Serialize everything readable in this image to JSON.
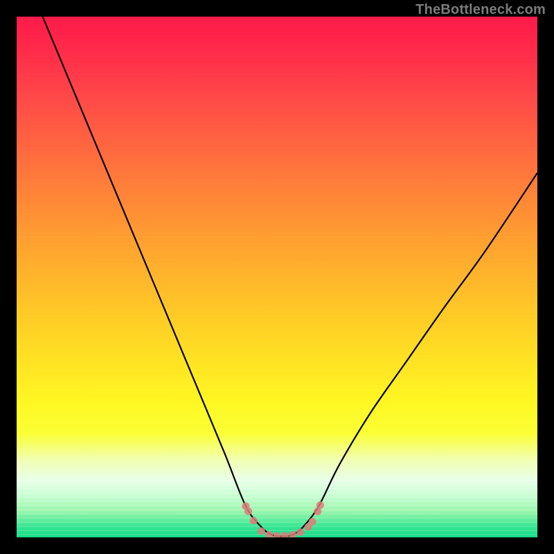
{
  "watermark": "TheBottleneck.com",
  "colors": {
    "background": "#000000",
    "gradient_top": "#ff1a4a",
    "gradient_mid": "#ffe223",
    "gradient_bottom": "#15db87",
    "curve": "#000000",
    "dot": "#e07a7a"
  },
  "chart_data": {
    "type": "line",
    "title": "",
    "xlabel": "",
    "ylabel": "",
    "xlim": [
      0,
      100
    ],
    "ylim": [
      0,
      100
    ],
    "grid": false,
    "series": [
      {
        "name": "bottleneck-curve",
        "x": [
          5,
          10,
          15,
          20,
          25,
          30,
          35,
          40,
          44,
          47,
          49,
          51,
          53,
          55,
          58,
          62,
          68,
          75,
          82,
          90,
          100
        ],
        "values": [
          100,
          88,
          76,
          64,
          52,
          40,
          28,
          16,
          6,
          2,
          0.5,
          0.2,
          0.5,
          2,
          6,
          14,
          24,
          34,
          44,
          55,
          70
        ]
      }
    ],
    "annotations": {
      "dots": [
        {
          "x": 44.0,
          "y": 6.0
        },
        {
          "x": 44.5,
          "y": 5.0
        },
        {
          "x": 45.5,
          "y": 3.2
        },
        {
          "x": 47.0,
          "y": 1.2
        },
        {
          "x": 48.5,
          "y": 0.5
        },
        {
          "x": 50.0,
          "y": 0.3
        },
        {
          "x": 51.5,
          "y": 0.3
        },
        {
          "x": 53.0,
          "y": 0.5
        },
        {
          "x": 54.5,
          "y": 1.0
        },
        {
          "x": 56.0,
          "y": 2.0
        },
        {
          "x": 56.8,
          "y": 3.0
        },
        {
          "x": 57.8,
          "y": 5.0
        },
        {
          "x": 58.3,
          "y": 6.2
        }
      ]
    }
  }
}
